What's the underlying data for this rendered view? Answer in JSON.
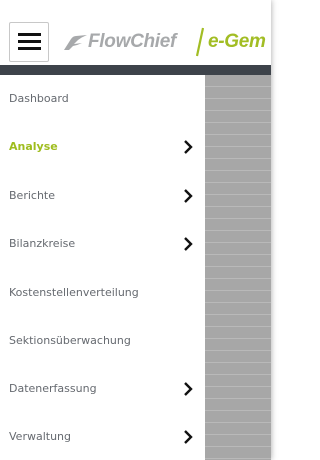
{
  "header": {
    "menu_icon": "hamburger-menu-icon",
    "logo_mark_icon": "flowchief-swoosh-icon",
    "brand_name": "FlowChief",
    "brand_product": "e-Gem",
    "brand_color_gray": "#a7a9ab",
    "brand_color_green": "#a2bd24"
  },
  "sidebar": {
    "items": [
      {
        "label": "Dashboard",
        "has_submenu": false,
        "active": false
      },
      {
        "label": "Analyse",
        "has_submenu": true,
        "active": true
      },
      {
        "label": "Berichte",
        "has_submenu": true,
        "active": false
      },
      {
        "label": "Bilanzkreise",
        "has_submenu": true,
        "active": false
      },
      {
        "label": "Kostenstellenverteilung",
        "has_submenu": false,
        "active": false
      },
      {
        "label": "Sektionsüberwachung",
        "has_submenu": false,
        "active": false
      },
      {
        "label": "Datenerfassung",
        "has_submenu": true,
        "active": false
      },
      {
        "label": "Verwaltung",
        "has_submenu": true,
        "active": false
      }
    ],
    "chevron_icon": "chevron-right-icon",
    "active_color": "#9fbd1e",
    "text_color": "#666a70"
  },
  "colors": {
    "topbar": "#3d434a",
    "overlay": "#a7a7a7"
  }
}
